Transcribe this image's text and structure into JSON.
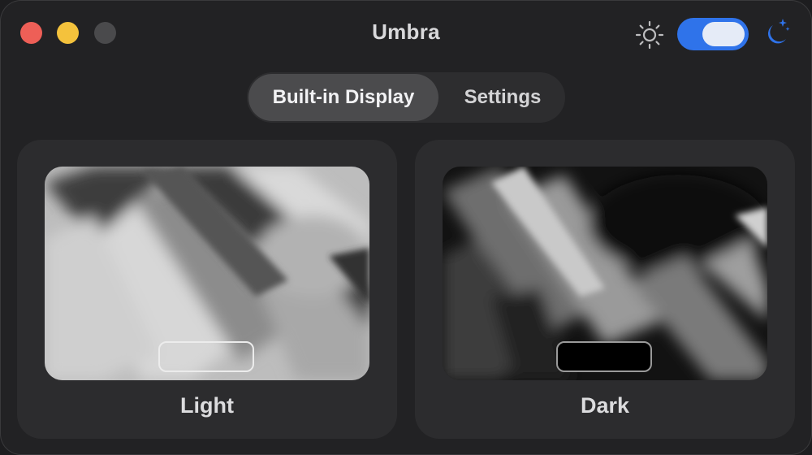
{
  "window": {
    "title": "Umbra"
  },
  "appearance_toggle": {
    "state": "on",
    "left_icon": "sun-icon",
    "right_icon": "moon-sparkle-icon",
    "accent": "#2f73ea"
  },
  "tabs": [
    {
      "label": "Built-in Display",
      "selected": true
    },
    {
      "label": "Settings",
      "selected": false
    }
  ],
  "modes": [
    {
      "label": "Light"
    },
    {
      "label": "Dark"
    }
  ],
  "colors": {
    "close": "#ee5f57",
    "minimize": "#f4c23c",
    "zoom": "#4a4a4c"
  }
}
